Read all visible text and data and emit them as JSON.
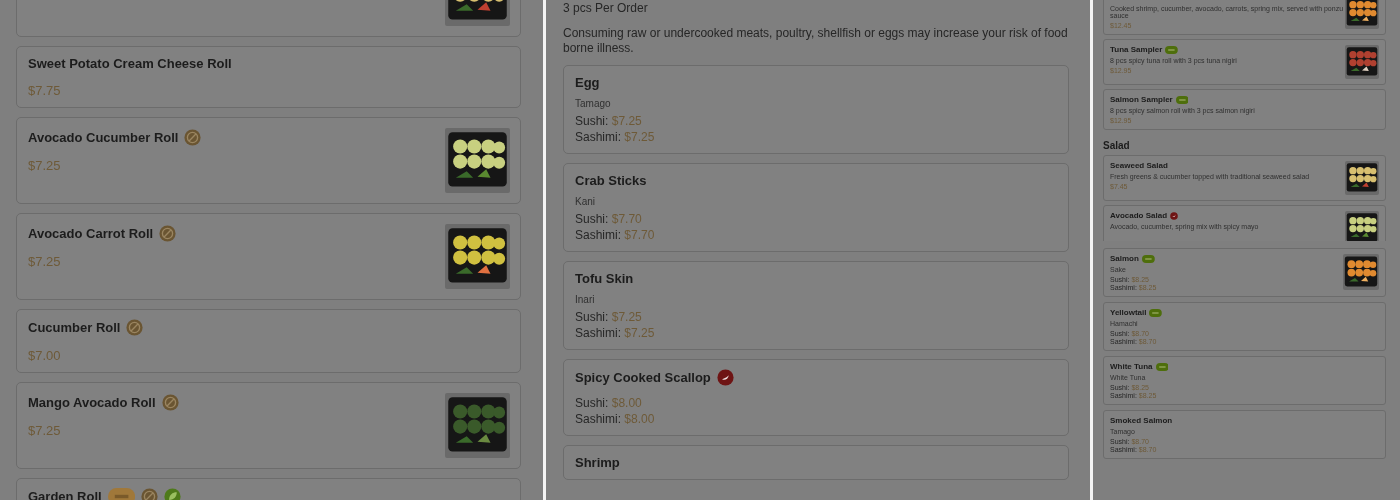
{
  "left_panel": {
    "items": [
      {
        "image": true
      },
      {
        "title": "Sweet Potato Cream Cheese Roll",
        "price": "$7.75"
      },
      {
        "title": "Avocado Cucumber Roll",
        "price": "$7.25",
        "badges": [
          {
            "kind": "vegetarian"
          }
        ],
        "image": true
      },
      {
        "title": "Avocado Carrot Roll",
        "price": "$7.25",
        "badges": [
          {
            "kind": "vegetarian"
          }
        ],
        "image": true
      },
      {
        "title": "Cucumber Roll",
        "price": "$7.00",
        "badges": [
          {
            "kind": "vegetarian"
          }
        ]
      },
      {
        "title": "Mango Avocado Roll",
        "price": "$7.25",
        "badges": [
          {
            "kind": "vegetarian"
          }
        ],
        "image": true
      },
      {
        "title": "Garden Roll",
        "badges": [
          {
            "kind": "pill_orange"
          },
          {
            "kind": "vegetarian"
          },
          {
            "kind": "vegan"
          }
        ]
      }
    ]
  },
  "middle_panel": {
    "note": "3 pcs Per Order",
    "disclaimer": "Consuming raw or undercooked meats, poultry, shellfish or eggs may increase your risk of food borne illness.",
    "items": [
      {
        "title": "Egg",
        "subtitle": "Tamago",
        "prices": [
          {
            "label": "Sushi:",
            "value": "$7.25"
          },
          {
            "label": "Sashimi:",
            "value": "$7.25"
          }
        ]
      },
      {
        "title": "Crab Sticks",
        "subtitle": "Kani",
        "prices": [
          {
            "label": "Sushi:",
            "value": "$7.70"
          },
          {
            "label": "Sashimi:",
            "value": "$7.70"
          }
        ]
      },
      {
        "title": "Tofu Skin",
        "subtitle": "Inari",
        "prices": [
          {
            "label": "Sushi:",
            "value": "$7.25"
          },
          {
            "label": "Sashimi:",
            "value": "$7.25"
          }
        ]
      },
      {
        "title": "Spicy Cooked Scallop",
        "prices": [
          {
            "label": "Sushi:",
            "value": "$8.00"
          },
          {
            "label": "Sashimi:",
            "value": "$8.00"
          }
        ],
        "badges": [
          {
            "kind": "spicy"
          }
        ]
      },
      {
        "title": "Shrimp"
      }
    ]
  },
  "right_top_panel": {
    "sections": [
      {
        "items": [
          {
            "description": "Cooked shrimp, cucumber, avocado, carrots, spring mix, served with ponzu sauce",
            "price": "$12.45",
            "image": true
          },
          {
            "title": "Tuna Sampler",
            "description": "8 pcs spicy tuna roll with 3 pcs tuna nigiri",
            "price": "$12.95",
            "badges": [
              {
                "kind": "pill_green"
              }
            ],
            "image": true
          },
          {
            "title": "Salmon Sampler",
            "description": "8 pcs spicy salmon roll with 3 pcs salmon nigiri",
            "price": "$12.95",
            "badges": [
              {
                "kind": "pill_green"
              }
            ]
          }
        ]
      },
      {
        "heading": "Salad",
        "items": [
          {
            "title": "Seaweed Salad",
            "description": "Fresh greens & cucumber topped with traditional seaweed salad",
            "price": "$7.45",
            "image": true
          },
          {
            "title": "Avocado Salad",
            "description": "Avocado, cucumber, spring mix with spicy mayo",
            "badges": [
              {
                "kind": "spicy"
              }
            ],
            "image": true
          }
        ]
      }
    ]
  },
  "right_bottom_panel": {
    "items": [
      {
        "title": "Salmon",
        "subtitle": "Sake",
        "prices": [
          {
            "label": "Sushi:",
            "value": "$8.25"
          },
          {
            "label": "Sashimi:",
            "value": "$8.25"
          }
        ],
        "badges": [
          {
            "kind": "pill_green"
          }
        ],
        "image": true
      },
      {
        "title": "Yellowtail",
        "subtitle": "Hamachi",
        "prices": [
          {
            "label": "Sushi:",
            "value": "$8.70"
          },
          {
            "label": "Sashimi:",
            "value": "$8.70"
          }
        ],
        "badges": [
          {
            "kind": "pill_green"
          }
        ]
      },
      {
        "title": "White Tuna",
        "subtitle": "White Tuna",
        "prices": [
          {
            "label": "Sushi:",
            "value": "$8.25"
          },
          {
            "label": "Sashimi:",
            "value": "$8.25"
          }
        ],
        "badges": [
          {
            "kind": "pill_green"
          }
        ]
      },
      {
        "title": "Smoked Salmon",
        "subtitle": "Tamago",
        "prices": [
          {
            "label": "Sushi:",
            "value": "$8.70"
          },
          {
            "label": "Sashimi:",
            "value": "$8.70"
          }
        ]
      }
    ]
  }
}
